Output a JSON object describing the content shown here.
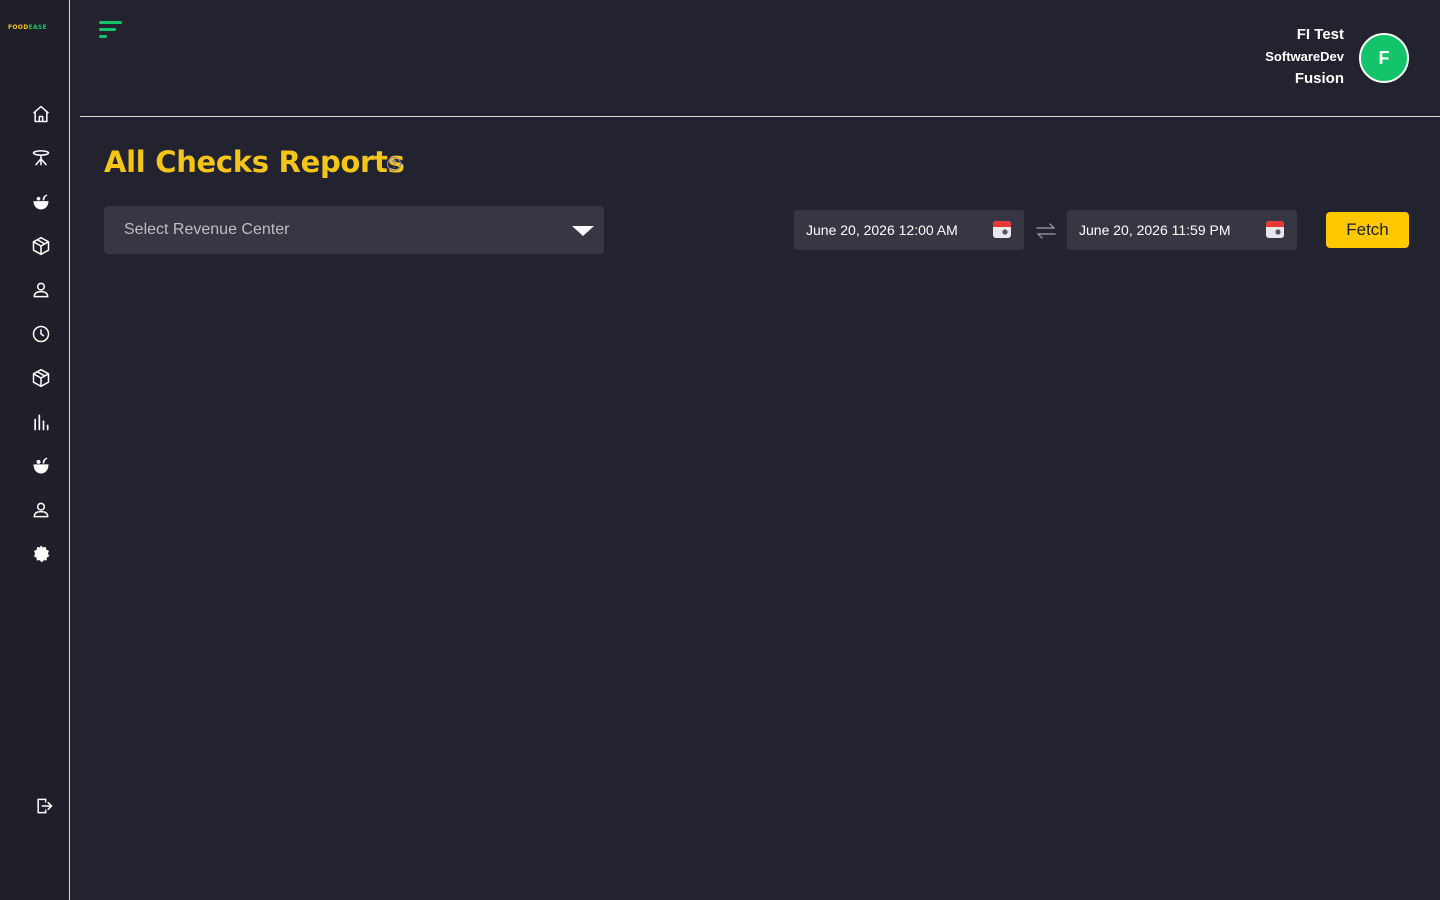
{
  "brand": {
    "logo_part1": "FOOD",
    "logo_part2": "EASE"
  },
  "sidebar": {
    "items": [
      {
        "icon": "home-icon"
      },
      {
        "icon": "dining-table-icon"
      },
      {
        "icon": "food-bowl-icon"
      },
      {
        "icon": "box-icon"
      },
      {
        "icon": "user-icon"
      },
      {
        "icon": "clock-icon"
      },
      {
        "icon": "package-icon"
      },
      {
        "icon": "bar-chart-icon"
      },
      {
        "icon": "food-bowl-filled-icon"
      },
      {
        "icon": "user-icon"
      },
      {
        "icon": "settings-gear-icon"
      }
    ],
    "logout_icon": "logout-icon"
  },
  "user": {
    "line1": "FI Test",
    "line2": "SoftwareDev",
    "line3": "Fusion",
    "avatar_letter": "F"
  },
  "page": {
    "title": "All Checks Reports"
  },
  "filters": {
    "revenue_center_placeholder": "Select Revenue Center",
    "start_date": "June 20, 2026 12:00 AM",
    "end_date": "June 20, 2026 11:59 PM",
    "fetch_label": "Fetch"
  },
  "colors": {
    "accent_yellow": "#f5c518",
    "accent_green": "#14c46a",
    "background": "#22232e",
    "sidebar_bg": "#1e1f29",
    "input_bg": "#363743"
  }
}
